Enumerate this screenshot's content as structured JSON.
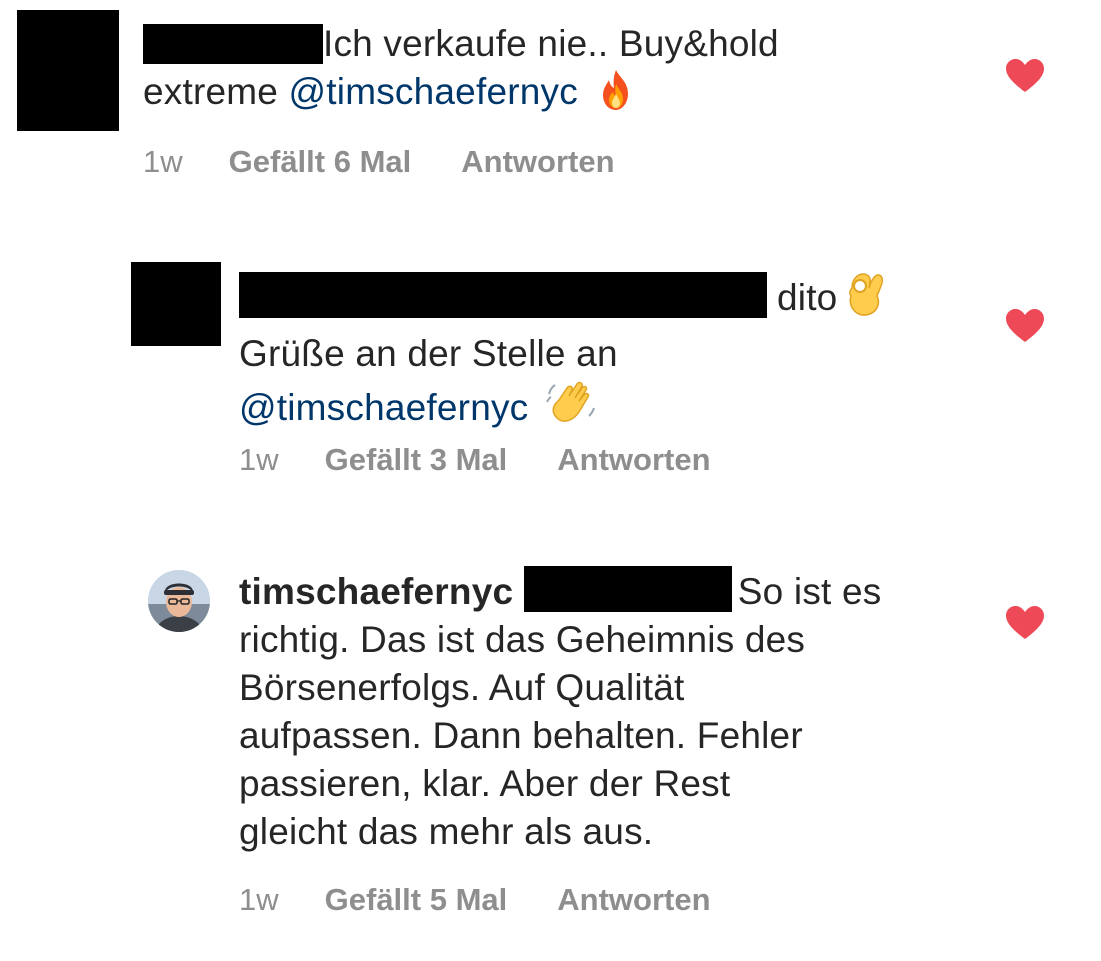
{
  "colors": {
    "text": "#262626",
    "meta": "#8e8e8e",
    "mention": "#00376b",
    "heart": "#ed4956",
    "redaction": "#000000"
  },
  "comments": [
    {
      "text_part1": "Ich verkaufe nie.. Buy&hold",
      "text_part2": "extreme",
      "mention": "@timschaefernyc",
      "emoji": "fire-emoji",
      "time": "1w",
      "likes": "Gefällt 6 Mal",
      "reply": "Antworten",
      "liked_icon": "heart-icon"
    },
    {
      "text_part1": "dito",
      "emoji1": "ok-hand-emoji",
      "text_part2": "Grüße an der Stelle an",
      "mention": "@timschaefernyc",
      "emoji2": "waving-hand-emoji",
      "time": "1w",
      "likes": "Gefällt 3 Mal",
      "reply": "Antworten",
      "liked_icon": "heart-icon"
    },
    {
      "username": "timschaefernyc",
      "text_line1": "So ist es",
      "text_line2": "richtig. Das ist das Geheimnis des",
      "text_line3": "Börsenerfolgs. Auf Qualität",
      "text_line4": "aufpassen. Dann behalten. Fehler",
      "text_line5": "passieren, klar. Aber der Rest",
      "text_line6": "gleicht das mehr als aus.",
      "time": "1w",
      "likes": "Gefällt 5 Mal",
      "reply": "Antworten",
      "liked_icon": "heart-icon"
    }
  ]
}
